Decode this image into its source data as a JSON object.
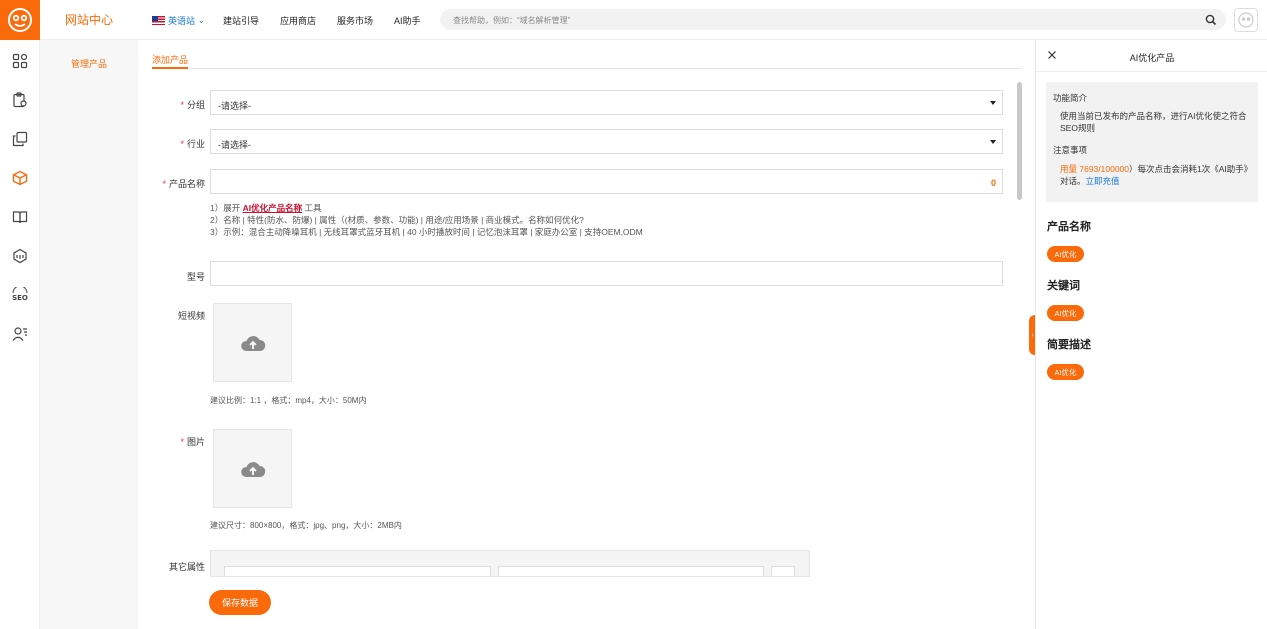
{
  "header": {
    "site_title": "网站中心",
    "language": "英语站",
    "nav": [
      "建站引导",
      "应用商店",
      "服务市场",
      "AI助手"
    ],
    "search_placeholder": "查找帮助，例如：“域名解析管理”"
  },
  "icons": {
    "logo": "bee-logo-icon",
    "rail": [
      "dashboard-icon",
      "clipboard-settings-icon",
      "copy-icon",
      "box-icon",
      "book-icon",
      "3d-cube-icon",
      "seo-icon",
      "users-icon"
    ],
    "search": "search-icon",
    "upload": "cloud-upload-icon"
  },
  "colors": {
    "accent": "#fa6a0a",
    "link": "#1677d9",
    "required": "#e8333a"
  },
  "sidebar": {
    "active_item": "管理产品"
  },
  "main": {
    "tab": "添加产品",
    "fields": {
      "group": {
        "label": "分组",
        "value": "-请选择-"
      },
      "industry": {
        "label": "行业",
        "value": "-请选择-"
      },
      "product_name": {
        "label": "产品名称",
        "value": "",
        "counter": "0"
      },
      "model": {
        "label": "型号",
        "value": ""
      },
      "video": {
        "label": "短视频",
        "note": "建议比例：1:1 ，格式：mp4，大小：50M内"
      },
      "image": {
        "label": "图片",
        "note": "建议尺寸：800×800，格式：jpg、png，大小：2MB内"
      },
      "other_attrs": {
        "label": "其它属性"
      }
    },
    "hint": {
      "line1_prefix": "1）展开",
      "line1_link": "AI优化产品名称",
      "line1_suffix": "工具",
      "line2": "2）名称 | 特性(防水、防爆) | 属性（(材质、参数、功能) | 用途/应用场景 | 商业模式。名称如何优化?",
      "line3": "3）示例：混合主动降噪耳机 | 无线耳罩式蓝牙耳机 | 40 小时播放时间 | 记忆泡沫耳罩 | 家庭办公室 | 支持OEM,ODM"
    },
    "save_label": "保存数据"
  },
  "panel": {
    "title": "AI优化产品",
    "intro_title": "功能简介",
    "intro_text": "使用当前已发布的产品名称，进行AI优化使之符合SEO规则",
    "notice_title": "注意事项",
    "usage_label": "用量 7693/100000",
    "usage_text": "）每次点击会消耗1次《AI助手》对话。",
    "recharge": "立即充值",
    "sections": [
      {
        "title": "产品名称",
        "button": "AI优化"
      },
      {
        "title": "关键词",
        "button": "AI优化"
      },
      {
        "title": "简要描述",
        "button": "AI优化"
      }
    ]
  }
}
